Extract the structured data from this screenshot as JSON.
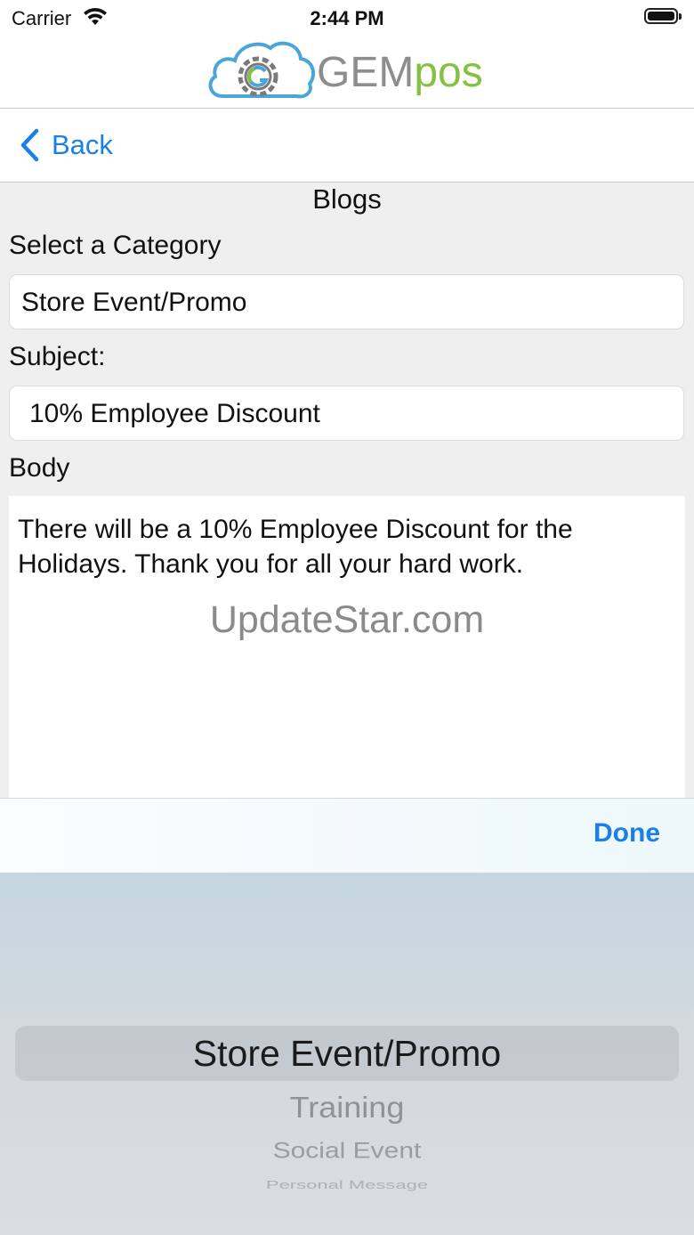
{
  "status_bar": {
    "carrier": "Carrier",
    "time": "2:44 PM"
  },
  "brand": {
    "name_part1": "GEM",
    "name_part2": "pos",
    "gem_color": "#8d8d8d",
    "pos_color": "#86c043",
    "cloud_color": "#4aa6d8"
  },
  "nav": {
    "back_label": "Back",
    "accent": "#1a7fe6"
  },
  "page": {
    "title": "Blogs"
  },
  "form": {
    "category_label": "Select a Category",
    "category_value": "Store Event/Promo",
    "subject_label": "Subject:",
    "subject_value": "10% Employee Discount",
    "body_label": "Body",
    "body_value": "There will be a 10% Employee Discount for the Holidays.  Thank you for all your hard work."
  },
  "watermark": "UpdateStar.com",
  "toolbar": {
    "done_label": "Done"
  },
  "picker": {
    "options": [
      "Store Event/Promo",
      "Training",
      "Social Event",
      "Personal Message"
    ],
    "selected": "Store Event/Promo"
  }
}
